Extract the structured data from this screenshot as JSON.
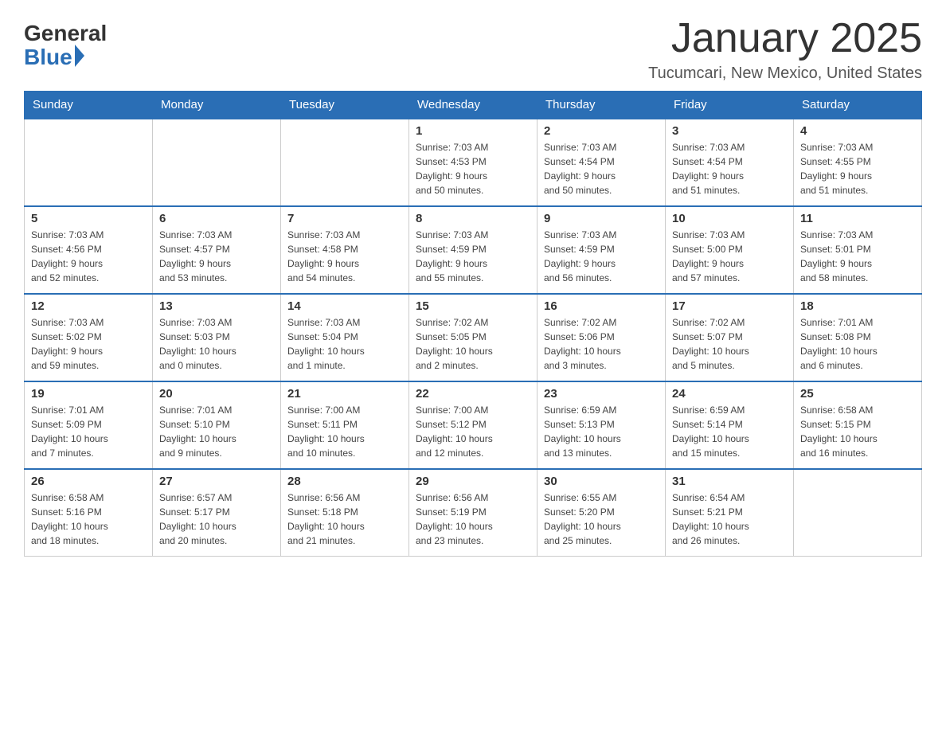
{
  "logo": {
    "general_text": "General",
    "blue_text": "Blue"
  },
  "header": {
    "title": "January 2025",
    "subtitle": "Tucumcari, New Mexico, United States"
  },
  "weekdays": [
    "Sunday",
    "Monday",
    "Tuesday",
    "Wednesday",
    "Thursday",
    "Friday",
    "Saturday"
  ],
  "weeks": [
    [
      {
        "day": "",
        "info": ""
      },
      {
        "day": "",
        "info": ""
      },
      {
        "day": "",
        "info": ""
      },
      {
        "day": "1",
        "info": "Sunrise: 7:03 AM\nSunset: 4:53 PM\nDaylight: 9 hours\nand 50 minutes."
      },
      {
        "day": "2",
        "info": "Sunrise: 7:03 AM\nSunset: 4:54 PM\nDaylight: 9 hours\nand 50 minutes."
      },
      {
        "day": "3",
        "info": "Sunrise: 7:03 AM\nSunset: 4:54 PM\nDaylight: 9 hours\nand 51 minutes."
      },
      {
        "day": "4",
        "info": "Sunrise: 7:03 AM\nSunset: 4:55 PM\nDaylight: 9 hours\nand 51 minutes."
      }
    ],
    [
      {
        "day": "5",
        "info": "Sunrise: 7:03 AM\nSunset: 4:56 PM\nDaylight: 9 hours\nand 52 minutes."
      },
      {
        "day": "6",
        "info": "Sunrise: 7:03 AM\nSunset: 4:57 PM\nDaylight: 9 hours\nand 53 minutes."
      },
      {
        "day": "7",
        "info": "Sunrise: 7:03 AM\nSunset: 4:58 PM\nDaylight: 9 hours\nand 54 minutes."
      },
      {
        "day": "8",
        "info": "Sunrise: 7:03 AM\nSunset: 4:59 PM\nDaylight: 9 hours\nand 55 minutes."
      },
      {
        "day": "9",
        "info": "Sunrise: 7:03 AM\nSunset: 4:59 PM\nDaylight: 9 hours\nand 56 minutes."
      },
      {
        "day": "10",
        "info": "Sunrise: 7:03 AM\nSunset: 5:00 PM\nDaylight: 9 hours\nand 57 minutes."
      },
      {
        "day": "11",
        "info": "Sunrise: 7:03 AM\nSunset: 5:01 PM\nDaylight: 9 hours\nand 58 minutes."
      }
    ],
    [
      {
        "day": "12",
        "info": "Sunrise: 7:03 AM\nSunset: 5:02 PM\nDaylight: 9 hours\nand 59 minutes."
      },
      {
        "day": "13",
        "info": "Sunrise: 7:03 AM\nSunset: 5:03 PM\nDaylight: 10 hours\nand 0 minutes."
      },
      {
        "day": "14",
        "info": "Sunrise: 7:03 AM\nSunset: 5:04 PM\nDaylight: 10 hours\nand 1 minute."
      },
      {
        "day": "15",
        "info": "Sunrise: 7:02 AM\nSunset: 5:05 PM\nDaylight: 10 hours\nand 2 minutes."
      },
      {
        "day": "16",
        "info": "Sunrise: 7:02 AM\nSunset: 5:06 PM\nDaylight: 10 hours\nand 3 minutes."
      },
      {
        "day": "17",
        "info": "Sunrise: 7:02 AM\nSunset: 5:07 PM\nDaylight: 10 hours\nand 5 minutes."
      },
      {
        "day": "18",
        "info": "Sunrise: 7:01 AM\nSunset: 5:08 PM\nDaylight: 10 hours\nand 6 minutes."
      }
    ],
    [
      {
        "day": "19",
        "info": "Sunrise: 7:01 AM\nSunset: 5:09 PM\nDaylight: 10 hours\nand 7 minutes."
      },
      {
        "day": "20",
        "info": "Sunrise: 7:01 AM\nSunset: 5:10 PM\nDaylight: 10 hours\nand 9 minutes."
      },
      {
        "day": "21",
        "info": "Sunrise: 7:00 AM\nSunset: 5:11 PM\nDaylight: 10 hours\nand 10 minutes."
      },
      {
        "day": "22",
        "info": "Sunrise: 7:00 AM\nSunset: 5:12 PM\nDaylight: 10 hours\nand 12 minutes."
      },
      {
        "day": "23",
        "info": "Sunrise: 6:59 AM\nSunset: 5:13 PM\nDaylight: 10 hours\nand 13 minutes."
      },
      {
        "day": "24",
        "info": "Sunrise: 6:59 AM\nSunset: 5:14 PM\nDaylight: 10 hours\nand 15 minutes."
      },
      {
        "day": "25",
        "info": "Sunrise: 6:58 AM\nSunset: 5:15 PM\nDaylight: 10 hours\nand 16 minutes."
      }
    ],
    [
      {
        "day": "26",
        "info": "Sunrise: 6:58 AM\nSunset: 5:16 PM\nDaylight: 10 hours\nand 18 minutes."
      },
      {
        "day": "27",
        "info": "Sunrise: 6:57 AM\nSunset: 5:17 PM\nDaylight: 10 hours\nand 20 minutes."
      },
      {
        "day": "28",
        "info": "Sunrise: 6:56 AM\nSunset: 5:18 PM\nDaylight: 10 hours\nand 21 minutes."
      },
      {
        "day": "29",
        "info": "Sunrise: 6:56 AM\nSunset: 5:19 PM\nDaylight: 10 hours\nand 23 minutes."
      },
      {
        "day": "30",
        "info": "Sunrise: 6:55 AM\nSunset: 5:20 PM\nDaylight: 10 hours\nand 25 minutes."
      },
      {
        "day": "31",
        "info": "Sunrise: 6:54 AM\nSunset: 5:21 PM\nDaylight: 10 hours\nand 26 minutes."
      },
      {
        "day": "",
        "info": ""
      }
    ]
  ]
}
